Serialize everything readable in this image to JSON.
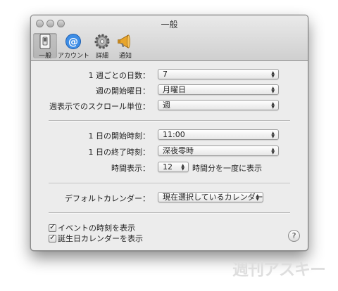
{
  "window": {
    "title": "一般"
  },
  "toolbar": {
    "items": [
      {
        "label": "一般",
        "icon": "switch-icon",
        "selected": true
      },
      {
        "label": "アカウント",
        "icon": "at-sign-icon",
        "selected": false
      },
      {
        "label": "詳細",
        "icon": "gear-icon",
        "selected": false
      },
      {
        "label": "通知",
        "icon": "megaphone-icon",
        "selected": false
      }
    ]
  },
  "general": {
    "days_per_week": {
      "label": "1 週ごとの日数：",
      "value": "7"
    },
    "week_start": {
      "label": "週の開始曜日：",
      "value": "月曜日"
    },
    "scroll_unit": {
      "label": "週表示でのスクロール単位：",
      "value": "週"
    }
  },
  "hours": {
    "day_start": {
      "label": "1 日の開始時刻：",
      "value": "11:00"
    },
    "day_end": {
      "label": "1 日の終了時刻：",
      "value": "深夜零時"
    },
    "show": {
      "label": "時間表示：",
      "value": "12",
      "suffix": "時間分を一度に表示"
    }
  },
  "default_calendar": {
    "label": "デフォルトカレンダー：",
    "value": "現在選択しているカレンダー"
  },
  "checkboxes": [
    {
      "label": "イベントの時刻を表示",
      "checked": true
    },
    {
      "label": "誕生日カレンダーを表示",
      "checked": true
    }
  ],
  "help": {
    "label": "?"
  },
  "watermark": "週刊アスキー"
}
